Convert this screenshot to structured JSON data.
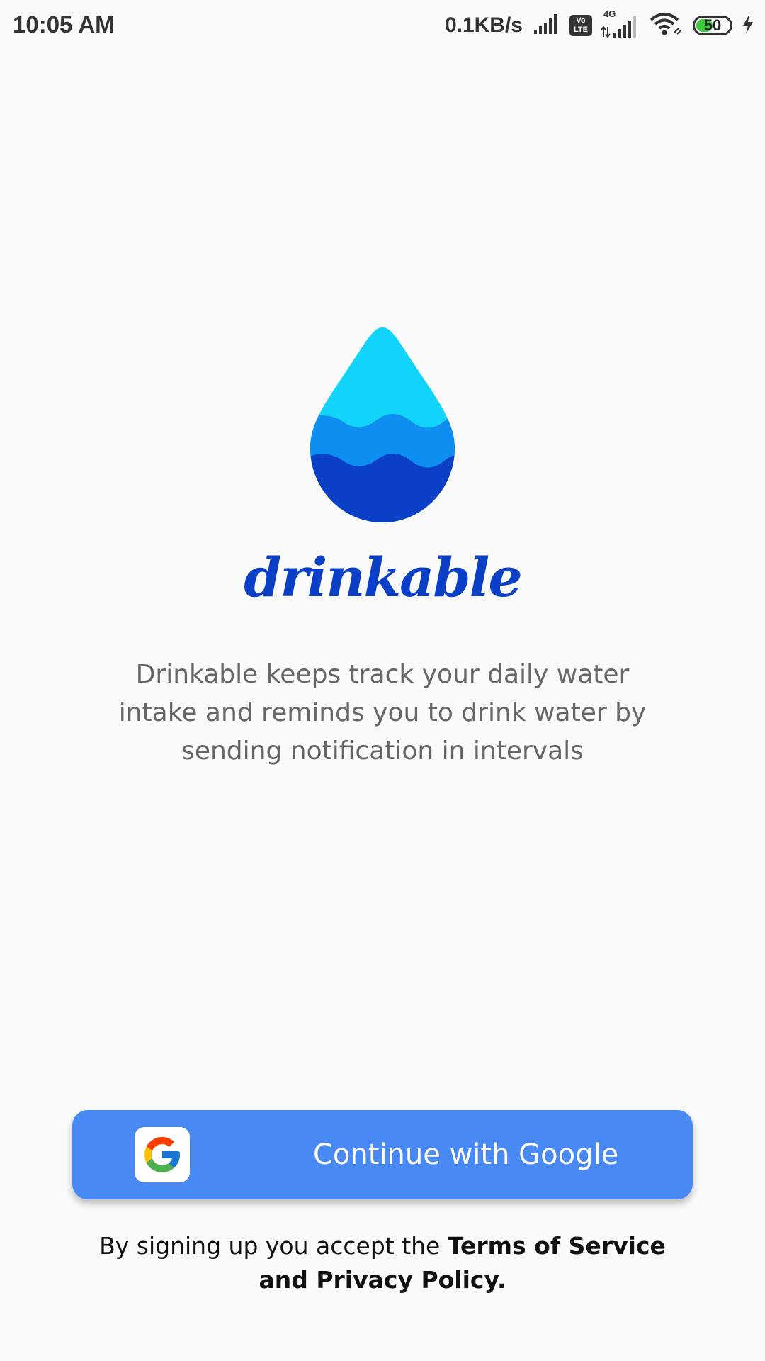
{
  "status_bar": {
    "time": "10:05 AM",
    "net_speed": "0.1KB/s",
    "volte_top": "Vo",
    "volte_bottom": "LTE",
    "network_type": "4G",
    "battery_level": "50"
  },
  "app": {
    "name": "drinkable",
    "description": "Drinkable keeps track your daily water intake and reminds you to drink water by sending notification in intervals"
  },
  "auth": {
    "google_button_label": "Continue with Google"
  },
  "legal": {
    "prefix": "By signing up you accept the ",
    "terms_link": "Terms of Service",
    "and_privacy_link": "and Privacy Policy."
  },
  "colors": {
    "background": "#fafafa",
    "brand_blue": "#0a3fc6",
    "button_blue": "#4889f4",
    "drop_light": "#12d4fb",
    "drop_mid": "#0d8ef0",
    "drop_dark": "#0a3fc6"
  }
}
